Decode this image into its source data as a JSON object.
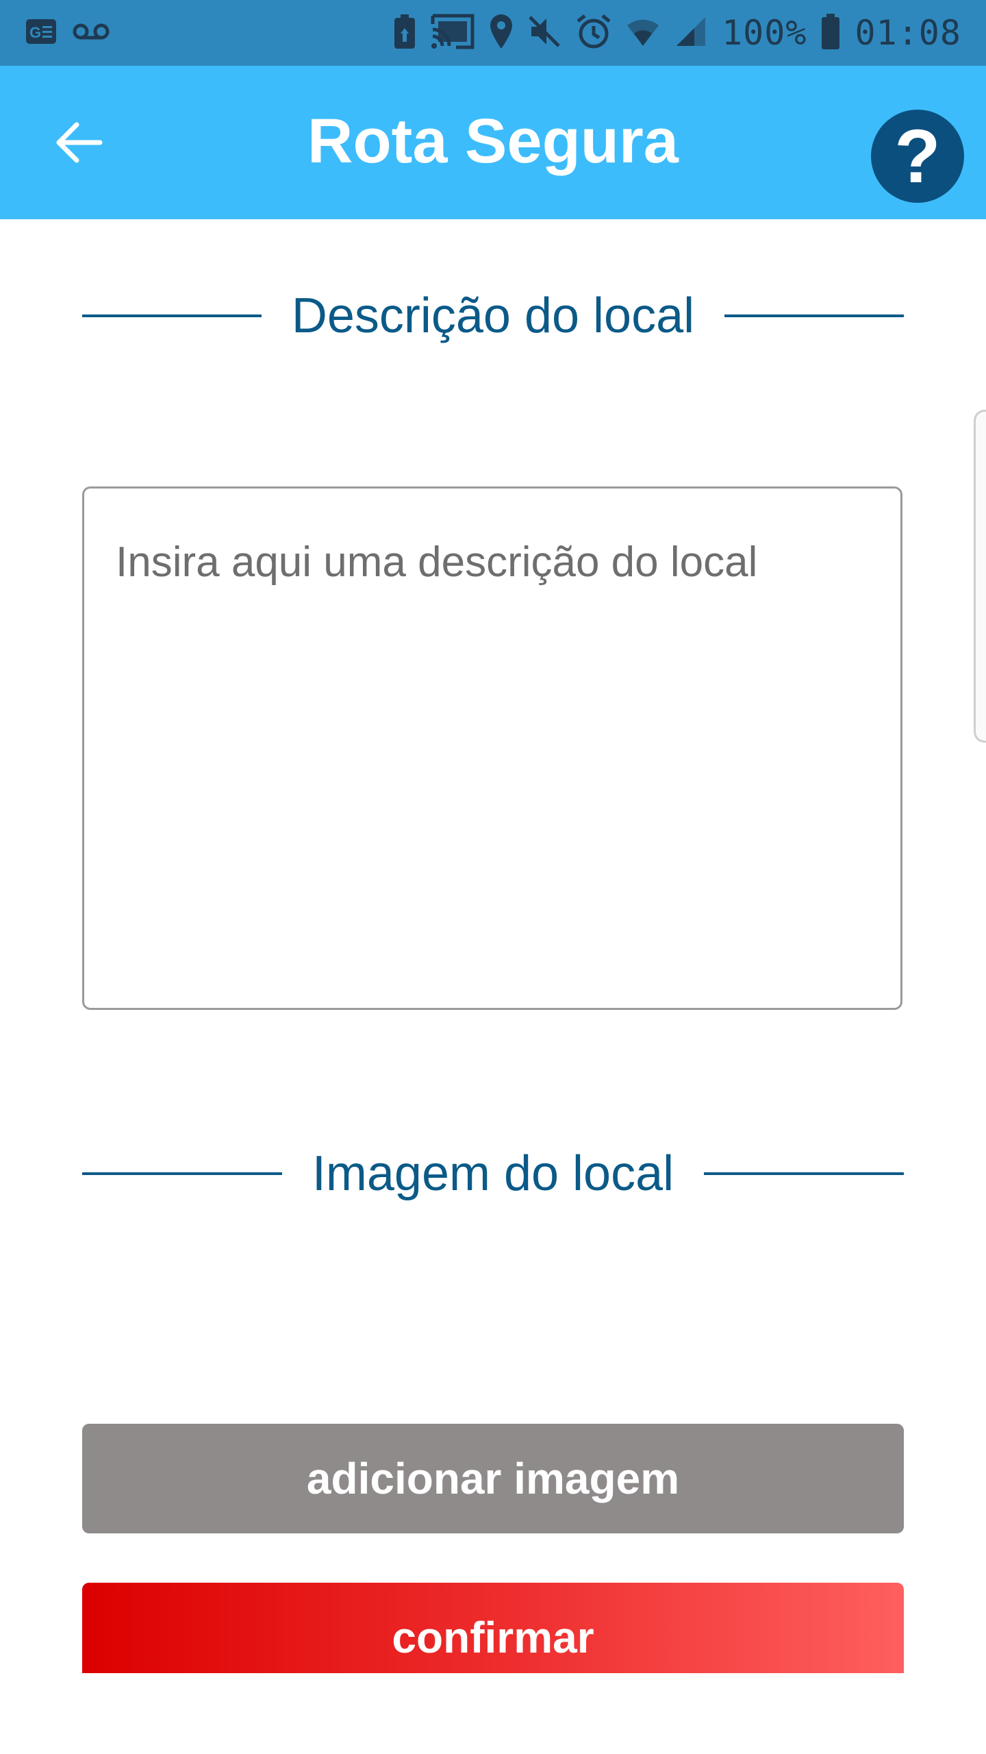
{
  "status_bar": {
    "battery_percent": "100%",
    "time": "01:08",
    "icons": [
      "news-icon",
      "voicemail-icon",
      "battery-saver-icon",
      "cast-icon",
      "location-icon",
      "mute-icon",
      "alarm-icon",
      "wifi-icon",
      "signal-icon",
      "battery-icon"
    ]
  },
  "app_bar": {
    "title": "Rota Segura",
    "back_icon": "arrow-left-icon",
    "help_label": "?",
    "background": "#3dbcfb"
  },
  "description_section": {
    "title": "Descrição do local",
    "placeholder": "Insira aqui uma descrição do local",
    "value": ""
  },
  "image_section": {
    "title": "Imagem do local"
  },
  "actions": {
    "add_image_label": "adicionar imagem",
    "confirm_label": "confirmar"
  },
  "colors": {
    "accent_dark": "#0b5a88",
    "status_bar": "#2f88bd",
    "add_button": "#8e8b8a",
    "confirm_start": "#dc0000",
    "confirm_end": "#ff5f5f"
  }
}
